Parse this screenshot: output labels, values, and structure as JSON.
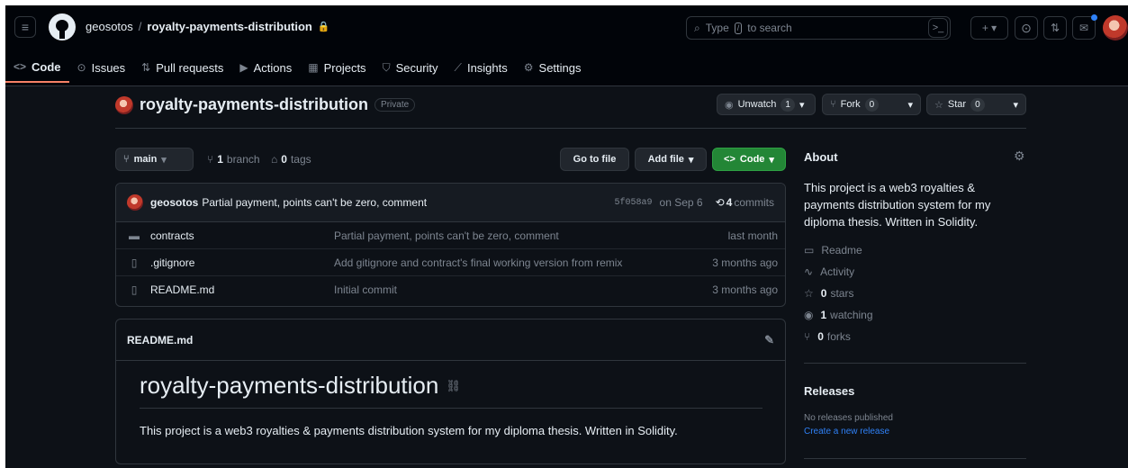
{
  "header": {
    "owner": "geosotos",
    "separator": "/",
    "repo": "royalty-payments-distribution",
    "search_placeholder": "Type / to search",
    "search_pre": "Type",
    "search_key": "/",
    "search_post": "to search"
  },
  "tabs": [
    {
      "label": "Code",
      "icon": "code-icon",
      "glyph": "<>"
    },
    {
      "label": "Issues",
      "icon": "issue-icon",
      "glyph": "⊙"
    },
    {
      "label": "Pull requests",
      "icon": "pull-request-icon",
      "glyph": "⇅"
    },
    {
      "label": "Actions",
      "icon": "play-icon",
      "glyph": "▶"
    },
    {
      "label": "Projects",
      "icon": "table-icon",
      "glyph": "▦"
    },
    {
      "label": "Security",
      "icon": "shield-icon",
      "glyph": "⛉"
    },
    {
      "label": "Insights",
      "icon": "graph-icon",
      "glyph": "⟋"
    },
    {
      "label": "Settings",
      "icon": "gear-icon",
      "glyph": "⚙"
    }
  ],
  "repo_head": {
    "title": "royalty-payments-distribution",
    "visibility": "Private",
    "unwatch_label": "Unwatch",
    "unwatch_count": "1",
    "fork_label": "Fork",
    "fork_count": "0",
    "star_label": "Star",
    "star_count": "0"
  },
  "toolbar": {
    "branch": "main",
    "branch_count": "1",
    "branch_word": "branch",
    "tag_count": "0",
    "tag_word": "tags",
    "goto_label": "Go to file",
    "addfile_label": "Add file",
    "code_label": "Code"
  },
  "commit": {
    "author": "geosotos",
    "message": "Partial payment, points can't be zero, comment",
    "sha": "5f058a9",
    "date": "on Sep 6",
    "commits_count": "4",
    "commits_word": "commits"
  },
  "files": [
    {
      "name": "contracts",
      "type": "folder",
      "message": "Partial payment, points can't be zero, comment",
      "time": "last month"
    },
    {
      "name": ".gitignore",
      "type": "file",
      "message": "Add gitignore and contract's final working version from remix",
      "time": "3 months ago"
    },
    {
      "name": "README.md",
      "type": "file",
      "message": "Initial commit",
      "time": "3 months ago"
    }
  ],
  "readme": {
    "header": "README.md",
    "heading": "royalty-payments-distribution",
    "body": "This project is a web3 royalties & payments distribution system for my diploma thesis. Written in Solidity."
  },
  "about": {
    "title": "About",
    "description": "This project is a web3 royalties & payments distribution system for my diploma thesis. Written in Solidity.",
    "readme": "Readme",
    "activity": "Activity",
    "stars_count": "0",
    "stars_word": "stars",
    "watching_count": "1",
    "watching_word": "watching",
    "forks_count": "0",
    "forks_word": "forks"
  },
  "releases": {
    "title": "Releases",
    "none": "No releases published",
    "create": "Create a new release"
  },
  "colors": {
    "background": "#0d1117",
    "header": "#010409",
    "accent_green": "#238636",
    "link": "#2f81f7",
    "tab_underline": "#f78166"
  }
}
